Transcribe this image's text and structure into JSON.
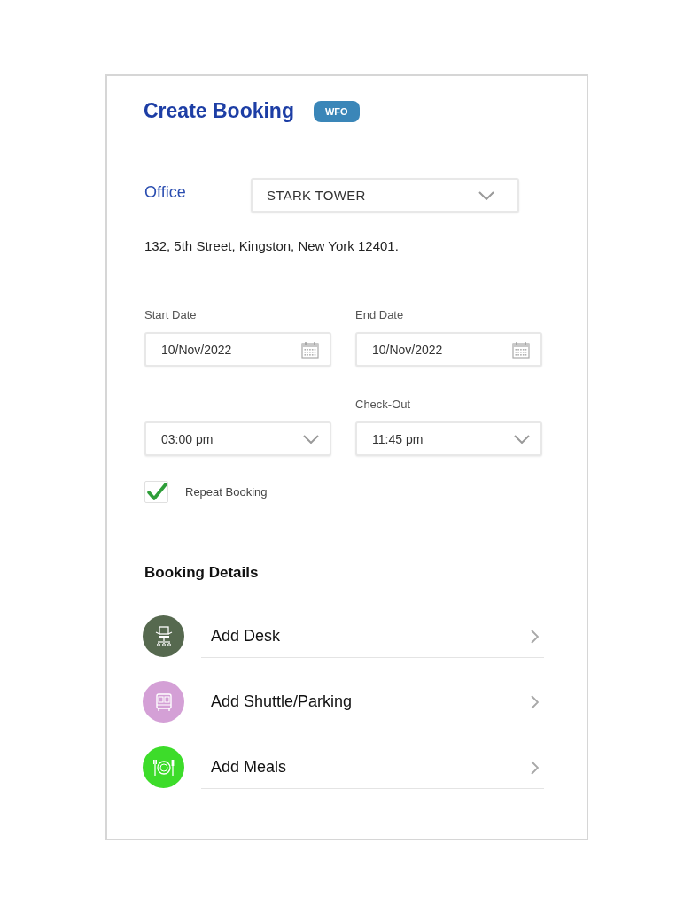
{
  "header": {
    "title": "Create Booking",
    "badge": "WFO"
  },
  "office": {
    "label": "Office",
    "value": "STARK TOWER",
    "address": "132, 5th Street, Kingston, New York 12401."
  },
  "dates": [
    {
      "label": "Start Date",
      "value": "10/Nov/2022"
    },
    {
      "label": "End Date",
      "value": "10/Nov/2022"
    }
  ],
  "times": [
    {
      "value": "03:00 pm"
    },
    {
      "label": "Check-Out",
      "value": "11:45 pm"
    }
  ],
  "repeat": {
    "label": "Repeat Booking",
    "checked": true
  },
  "booking_details": {
    "title": "Booking Details",
    "options": [
      {
        "kind": "desk",
        "label": "Add Desk",
        "color": "#56694f"
      },
      {
        "kind": "shuttle",
        "label": "Add Shuttle/Parking",
        "color": "#d4a0d6"
      },
      {
        "kind": "meal",
        "label": "Add Meals",
        "color": "#3ddc2a"
      }
    ]
  }
}
